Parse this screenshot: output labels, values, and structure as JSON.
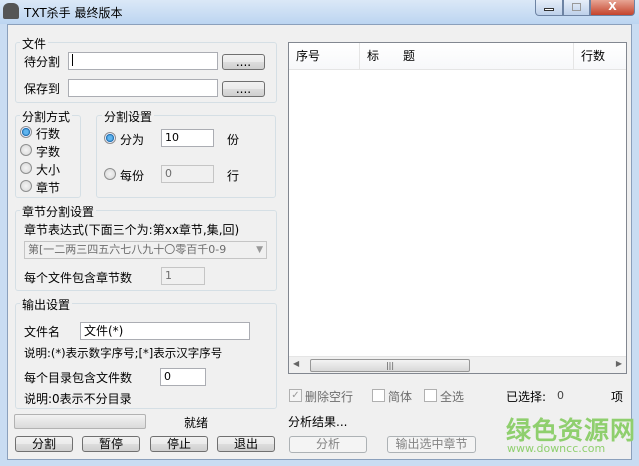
{
  "window": {
    "title": "TXT杀手 最终版本",
    "close_glyph": "X"
  },
  "file_group": {
    "label": "文件",
    "split_label": "待分割",
    "split_value": "",
    "save_label": "保存到",
    "save_value": "",
    "browse": "...."
  },
  "mode_group": {
    "label": "分割方式",
    "options": [
      "行数",
      "字数",
      "大小",
      "章节"
    ],
    "selected": 0
  },
  "settings_group": {
    "label": "分割设置",
    "parts_label": "分为",
    "parts_value": "10",
    "parts_unit": "份",
    "each_label": "每份",
    "each_value": "0",
    "each_unit": "行",
    "selected": 0
  },
  "chapter_group": {
    "label": "章节分割设置",
    "expr_label": "章节表达式(下面三个为:第xx章节,集,回)",
    "expr_value": "第[一二两三四五六七八九十〇零百千0-9",
    "per_file_label": "每个文件包含章节数",
    "per_file_value": "1"
  },
  "output_group": {
    "label": "输出设置",
    "filename_label": "文件名",
    "filename_value": "文件(*)",
    "note1": "说明:(*)表示数字序号;[*]表示汉字序号",
    "per_dir_label": "每个目录包含文件数",
    "per_dir_value": "0",
    "note2": "说明:0表示不分目录"
  },
  "status": {
    "text": "就绪",
    "progress": 0
  },
  "buttons": {
    "split": "分割",
    "pause": "暂停",
    "stop": "停止",
    "exit": "退出",
    "analyze": "分析",
    "export": "输出选中章节"
  },
  "list": {
    "columns": [
      "序号",
      "标　　题",
      "行数"
    ],
    "rows": []
  },
  "options": {
    "delete_blank": "删除空行",
    "delete_blank_checked": true,
    "simplified": "简体",
    "simplified_checked": false,
    "select_all": "全选",
    "select_all_checked": false
  },
  "selected": {
    "label": "已选择:",
    "count": "0",
    "unit": "项"
  },
  "analysis": {
    "text": "分析结果..."
  },
  "watermark": {
    "name": "绿色资源网",
    "url": "www.downcc.com"
  }
}
